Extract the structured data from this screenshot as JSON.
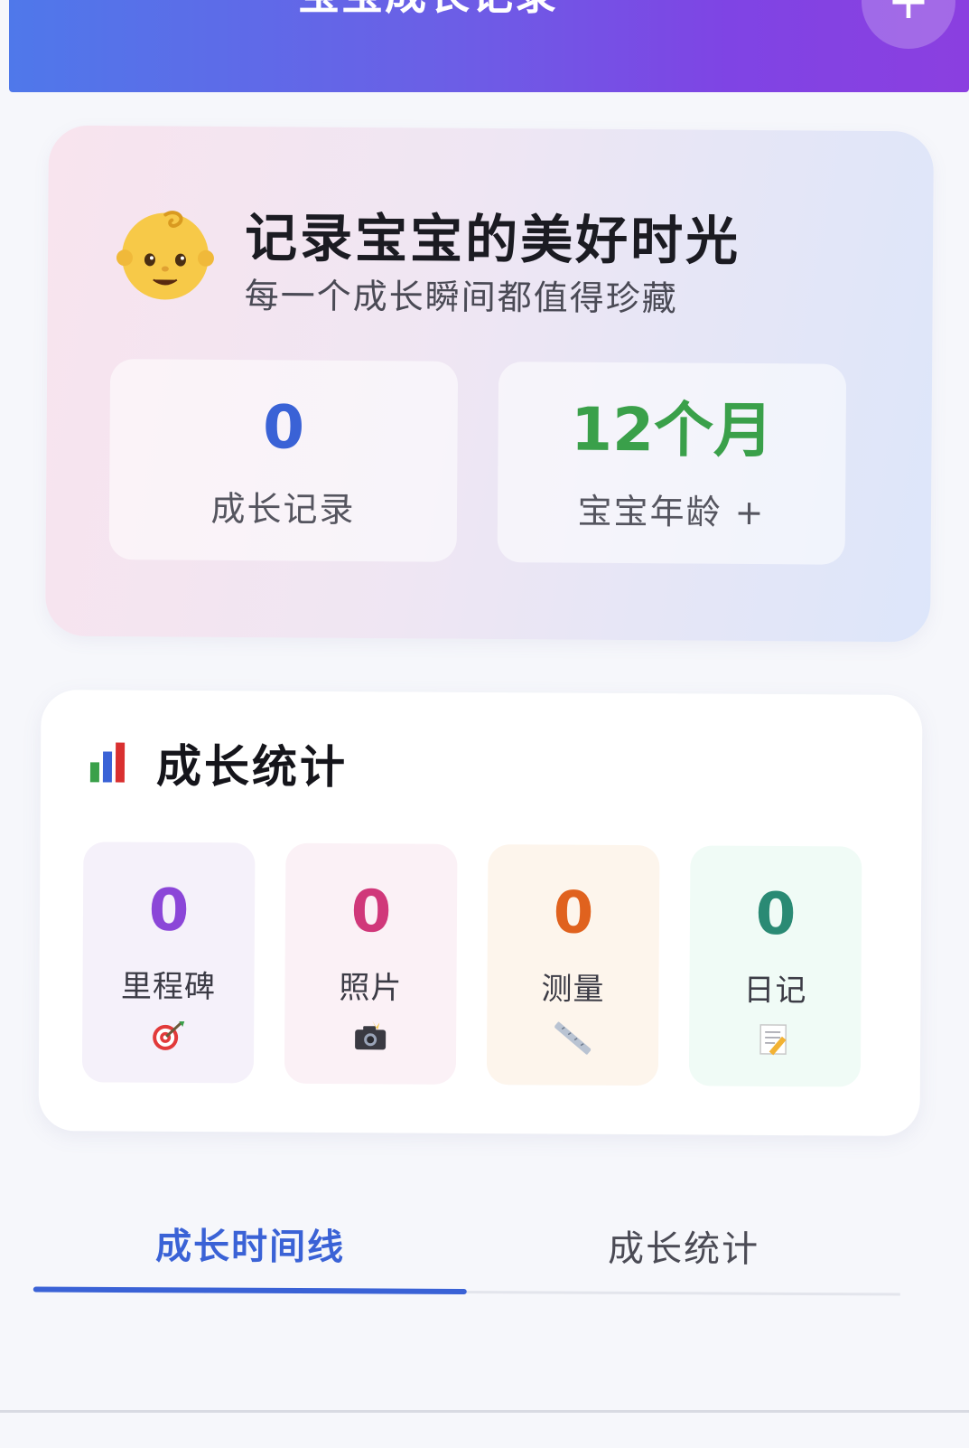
{
  "header": {
    "title": "宝宝成长记录",
    "add_button_label": "+"
  },
  "hero": {
    "icon": "baby-face-icon",
    "title": "记录宝宝的美好时光",
    "subtitle": "每一个成长瞬间都值得珍藏",
    "stats": [
      {
        "value": "0",
        "label": "成长记录",
        "color": "#3a62d6"
      },
      {
        "value": "12个月",
        "label": "宝宝年龄 +",
        "color": "#3aa04a"
      }
    ]
  },
  "growth_stats": {
    "icon": "bar-chart-icon",
    "title": "成长统计",
    "tiles": [
      {
        "value": "0",
        "label": "里程碑",
        "icon": "target-icon",
        "color": "#8b46d8",
        "bg": "#f5f1fa"
      },
      {
        "value": "0",
        "label": "照片",
        "icon": "camera-flash-icon",
        "color": "#d0387a",
        "bg": "#fbf1f6"
      },
      {
        "value": "0",
        "label": "测量",
        "icon": "ruler-icon",
        "color": "#e0621e",
        "bg": "#fdf5ec"
      },
      {
        "value": "0",
        "label": "日记",
        "icon": "memo-icon",
        "color": "#2a8a74",
        "bg": "#f0fbf6"
      }
    ]
  },
  "tabs": {
    "items": [
      {
        "label": "成长时间线",
        "active": true
      },
      {
        "label": "成长统计",
        "active": false
      }
    ]
  },
  "colors": {
    "accent": "#3a62d6",
    "header_gradient_start": "#4f78ea",
    "header_gradient_end": "#8b3fe0"
  }
}
